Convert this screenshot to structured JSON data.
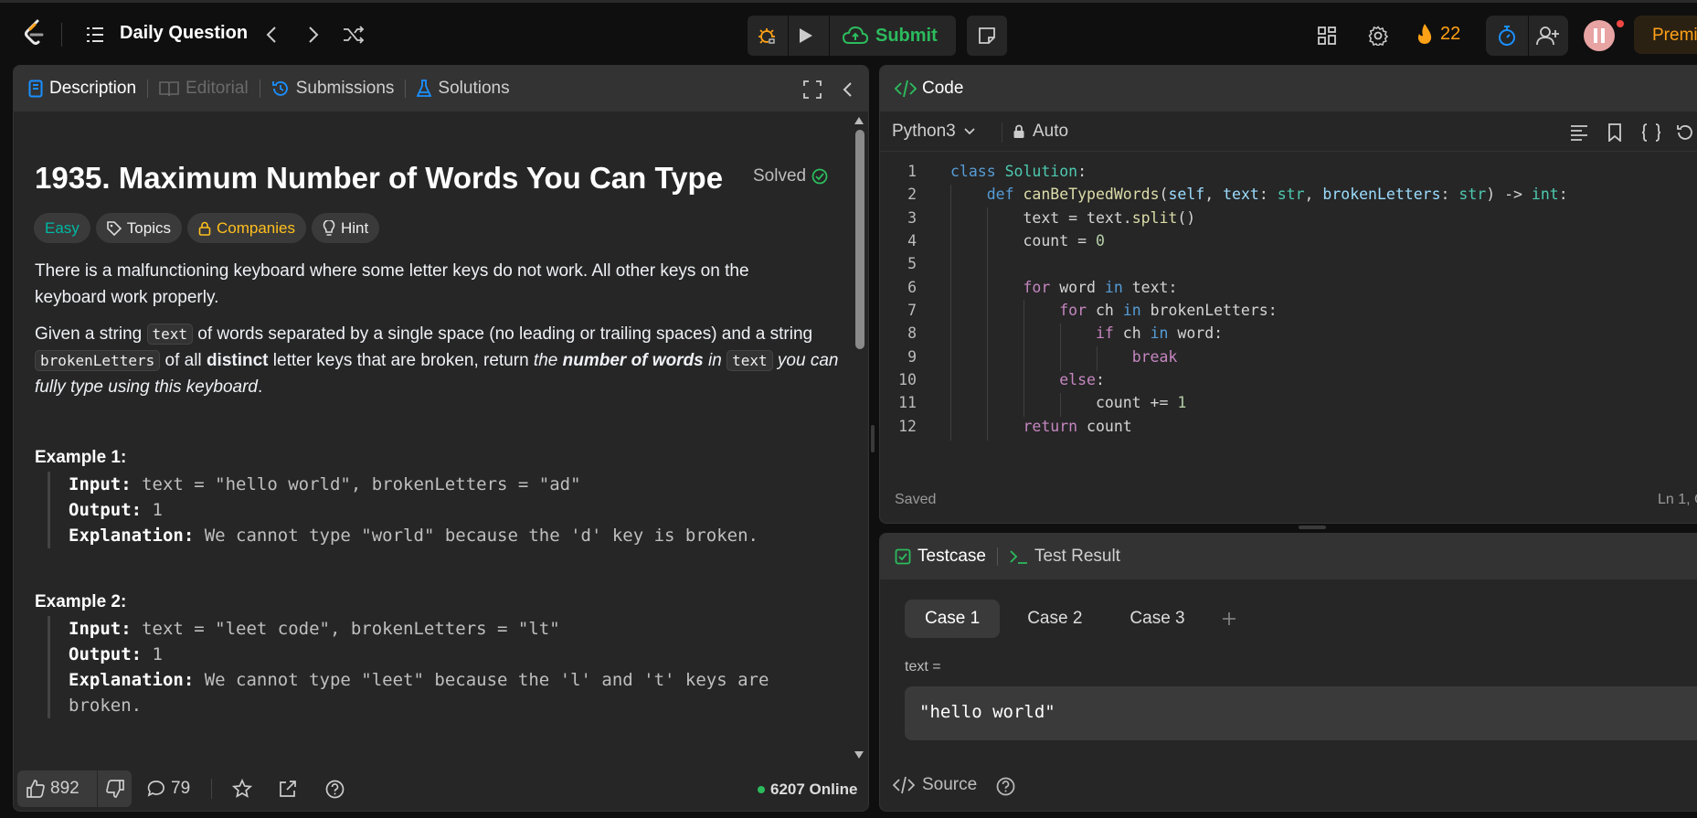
{
  "topbar": {
    "title": "Daily Question",
    "submit_label": "Submit",
    "streak_count": "22",
    "premium_label": "Premi"
  },
  "desc_panel": {
    "tabs": [
      {
        "label": "Description"
      },
      {
        "label": "Editorial"
      },
      {
        "label": "Submissions"
      },
      {
        "label": "Solutions"
      }
    ],
    "problem_title": "1935. Maximum Number of Words You Can Type",
    "solved_label": "Solved",
    "tags": {
      "difficulty": "Easy",
      "topics": "Topics",
      "companies": "Companies",
      "hint": "Hint"
    },
    "para1": "There is a malfunctioning keyboard where some letter keys do not work. All other keys on the keyboard work properly.",
    "para2": {
      "t1": "Given a string ",
      "c1": "text",
      "t2": " of words separated by a single space (no leading or trailing spaces) and a string ",
      "c2": "brokenLetters",
      "t3": " of all ",
      "b1": "distinct",
      "t4": " letter keys that are broken, return ",
      "i1": "the ",
      "ib1": "number of words",
      "i2": " in ",
      "c3": "text",
      "i3": " you can fully type using this keyboard",
      "t5": "."
    },
    "examples": [
      {
        "title": "Example 1:",
        "input_label": "Input:",
        "input": " text = \"hello world\", brokenLetters = \"ad\"",
        "output_label": "Output:",
        "output": " 1",
        "expl_label": "Explanation:",
        "explanation": " We cannot type \"world\" because the 'd' key is broken."
      },
      {
        "title": "Example 2:",
        "input_label": "Input:",
        "input": " text = \"leet code\", brokenLetters = \"lt\"",
        "output_label": "Output:",
        "output": " 1",
        "expl_label": "Explanation:",
        "explanation": " We cannot type \"leet\" because the 'l' and 't' keys are",
        "explanation2": "broken."
      }
    ],
    "footer": {
      "likes": "892",
      "comments": "79",
      "online": "6207 Online"
    }
  },
  "code_panel": {
    "title": "Code",
    "language": "Python3",
    "mode": "Auto",
    "status": "Saved",
    "cursor": "Ln 1, C",
    "line_numbers": [
      "1",
      "2",
      "3",
      "4",
      "5",
      "6",
      "7",
      "8",
      "9",
      "10",
      "11",
      "12"
    ]
  },
  "test_panel": {
    "tabs": [
      {
        "label": "Testcase"
      },
      {
        "label": "Test Result"
      }
    ],
    "cases": [
      "Case 1",
      "Case 2",
      "Case 3"
    ],
    "param_label": "text =",
    "param_value": "\"hello world\"",
    "source_label": "Source"
  },
  "colors": {
    "accent_orange": "#ffa116",
    "accent_green": "#2cbb5d",
    "easy": "#00b8a3",
    "companies": "#ffc01e",
    "blue": "#1a90ff"
  }
}
